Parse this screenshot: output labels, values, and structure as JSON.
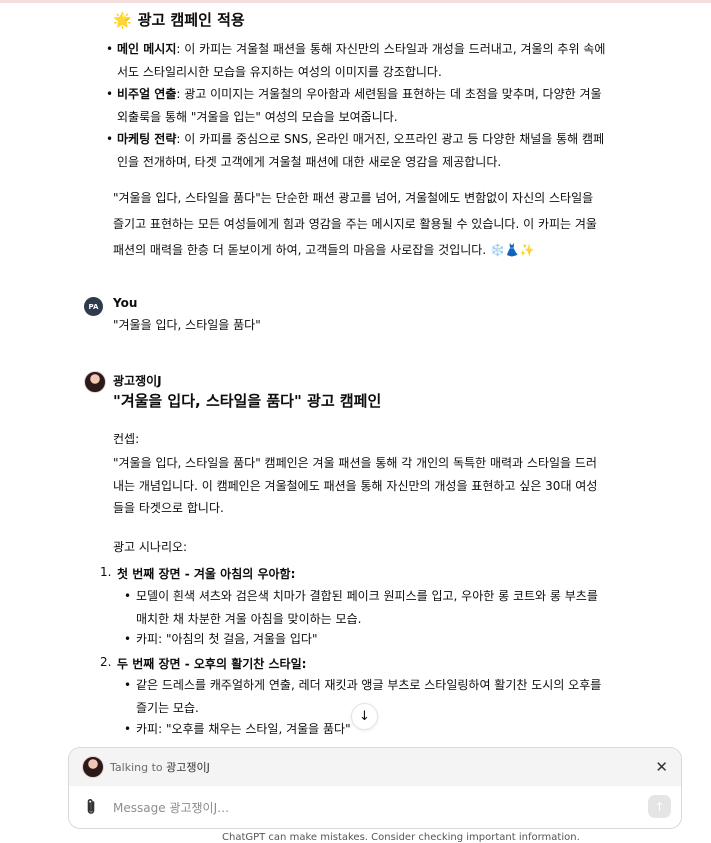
{
  "section1": {
    "heading": "광고 캠페인 적용",
    "bullets": [
      {
        "label": "메인 메시지",
        "text": ": 이 카피는 겨울철 패션을 통해 자신만의 스타일과 개성을 드러내고, 겨울의 추위 속에서도 스타일리시한 모습을 유지하는 여성의 이미지를 강조합니다."
      },
      {
        "label": "비주얼 연출",
        "text": ": 광고 이미지는 겨울철의 우아함과 세련됨을 표현하는 데 초점을 맞추며, 다양한 겨울 외출룩을 통해 \"겨울을 입는\" 여성의 모습을 보여줍니다."
      },
      {
        "label": "마케팅 전략",
        "text": ": 이 카피를 중심으로 SNS, 온라인 매거진, 오프라인 광고 등 다양한 채널을 통해 캠페인을 전개하며, 타겟 고객에게 겨울철 패션에 대한 새로운 영감을 제공합니다."
      }
    ],
    "closing": "\"겨울을 입다, 스타일을 품다\"는 단순한 패션 광고를 넘어, 겨울철에도 변함없이 자신의 스타일을 즐기고 표현하는 모든 여성들에게 힘과 영감을 주는 메시지로 활용될 수 있습니다. 이 카피는 겨울 패션의 매력을 한층 더 돋보이게 하여, 고객들의 마음을 사로잡을 것입니다. ❄️👗✨"
  },
  "user_message": {
    "avatar_initials": "PA",
    "name": "You",
    "text": "\"겨울을 입다, 스타일을 품다\""
  },
  "assistant_message": {
    "name": "광고쟁이J",
    "title": "\"겨울을 입다, 스타일을 품다\" 광고 캠페인",
    "concept_label": "컨셉:",
    "concept_text": "\"겨울을 입다, 스타일을 품다\" 캠페인은 겨울 패션을 통해 각 개인의 독특한 매력과 스타일을 드러내는 개념입니다. 이 캠페인은 겨울철에도 패션을 통해 자신만의 개성을 표현하고 싶은 30대 여성들을 타겟으로 합니다.",
    "scenario_label": "광고 시나리오:",
    "steps": [
      {
        "num": "1.",
        "title": "첫 번째 장면 - 겨울 아침의 우아함:",
        "items": [
          "모델이 흰색 셔츠와 검은색 치마가 결합된 페이크 원피스를 입고, 우아한 롱 코트와 롱 부츠를 매치한 채 차분한 겨울 아침을 맞이하는 모습.",
          "카피: \"아침의 첫 걸음, 겨울을 입다\""
        ]
      },
      {
        "num": "2.",
        "title": "두 번째 장면 - 오후의 활기찬 스타일:",
        "items": [
          "같은 드레스를 캐주얼하게 연출, 레더 재킷과 앵글 부츠로 스타일링하여 활기찬 도시의 오후를 즐기는 모습.",
          "카피: \"오후를 채우는 스타일, 겨울을 품다\""
        ]
      }
    ]
  },
  "composer": {
    "talking_prefix": "Talking to",
    "talking_name": "광고쟁이J",
    "placeholder": "Message 광고쟁이J…",
    "close_icon": "close-icon",
    "attach_icon": "paperclip-icon",
    "send_icon": "arrow-up-icon"
  },
  "footer": {
    "disclaimer": "ChatGPT can make mistakes. Consider checking important information."
  }
}
